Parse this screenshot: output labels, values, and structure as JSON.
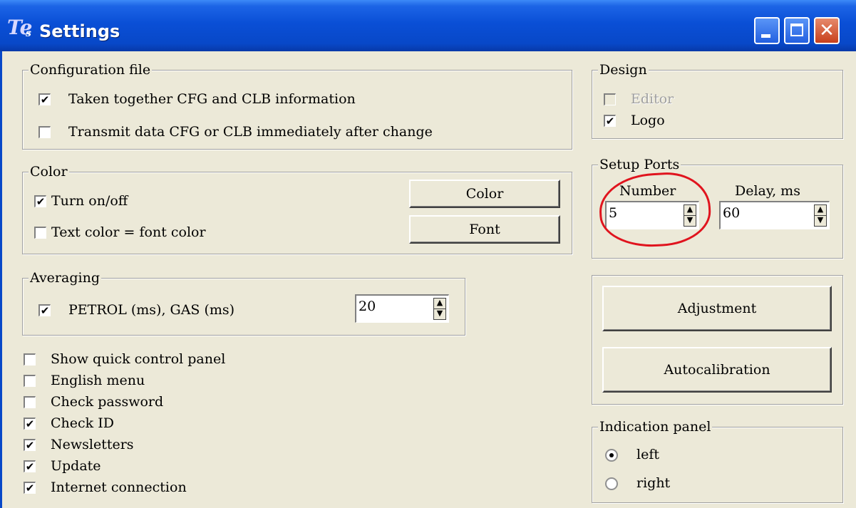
{
  "window": {
    "title": "Settings",
    "icon_text": "Te",
    "icon_subscript": "s",
    "min_glyph": "",
    "close_glyph": "✕"
  },
  "config": {
    "legend": "Configuration file",
    "items": [
      {
        "label": "Taken together CFG and CLB information",
        "checked": "✔"
      },
      {
        "label": "Transmit data CFG or CLB immediately after change",
        "checked": ""
      }
    ]
  },
  "color": {
    "legend": "Color",
    "turn_label": "Turn on/off",
    "turn_checked": "✔",
    "text_label": "Text color = font color",
    "text_checked": "",
    "color_button": "Color",
    "font_button": "Font"
  },
  "averaging": {
    "legend": "Averaging",
    "label": "PETROL (ms), GAS (ms)",
    "checked": "✔",
    "value": "20"
  },
  "options": [
    {
      "label": "Show quick control panel",
      "checked": ""
    },
    {
      "label": "English menu",
      "checked": ""
    },
    {
      "label": "Check password",
      "checked": ""
    },
    {
      "label": "Check ID",
      "checked": "✔"
    },
    {
      "label": "Newsletters",
      "checked": "✔"
    },
    {
      "label": "Update",
      "checked": "✔"
    },
    {
      "label": "Internet connection",
      "checked": "✔"
    }
  ],
  "design": {
    "legend": "Design",
    "editor_label": "Editor",
    "editor_checked": "",
    "logo_label": "Logo",
    "logo_checked": "✔"
  },
  "ports": {
    "legend": "Setup Ports",
    "number_label": "Number",
    "number_value": "5",
    "delay_label": "Delay, ms",
    "delay_value": "60"
  },
  "buttons": {
    "adjustment": "Adjustment",
    "autocalibration": "Autocalibration"
  },
  "indication": {
    "legend": "Indication panel",
    "left_label": "left",
    "right_label": "right",
    "selected": "left"
  },
  "spinner_glyphs": {
    "up": "▲",
    "down": "▼"
  },
  "colors": {
    "annotation": "#e0141e",
    "titlebar": "#0848c8"
  }
}
